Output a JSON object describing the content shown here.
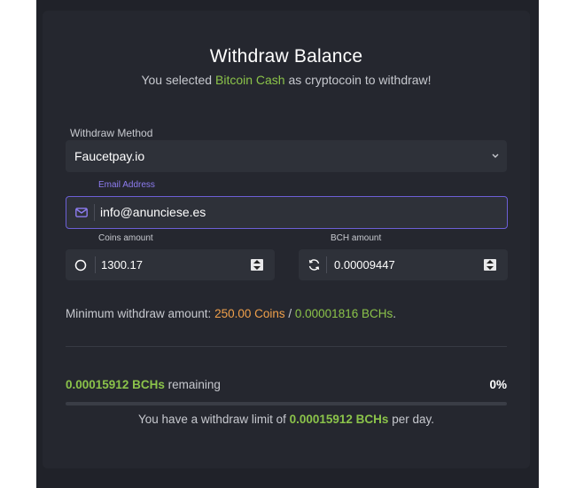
{
  "header": {
    "title": "Withdraw Balance",
    "subtitle_pre": "You selected ",
    "coin_name": "Bitcoin Cash",
    "subtitle_post": " as cryptocoin to withdraw!"
  },
  "withdraw_method": {
    "label": "Withdraw Method",
    "value": "Faucetpay.io",
    "chevron": "⌄"
  },
  "email": {
    "label": "Email Address",
    "value": "info@anunciese.es",
    "icon": "envelope-icon"
  },
  "coins": {
    "label": "Coins amount",
    "value": "1300.17",
    "icon": "circle-icon"
  },
  "bch": {
    "label": "BCH amount",
    "value": "0.00009447",
    "icon": "refresh-icon"
  },
  "minimum": {
    "prefix": "Minimum withdraw amount: ",
    "coins": "250.00 Coins",
    "separator": " / ",
    "bch": "0.00001816 BCHs",
    "suffix": "."
  },
  "remaining": {
    "amount": "0.00015912 BCHs",
    "label": " remaining",
    "percent": "0%",
    "progress": 0
  },
  "limit": {
    "prefix": "You have a withdraw limit of ",
    "amount": "0.00015912 BCHs",
    "suffix": " per day."
  },
  "colors": {
    "accent_green": "#8bc34a",
    "accent_orange": "#f0a04b",
    "focus_purple": "#6c5fd6",
    "panel": "#25272f"
  }
}
